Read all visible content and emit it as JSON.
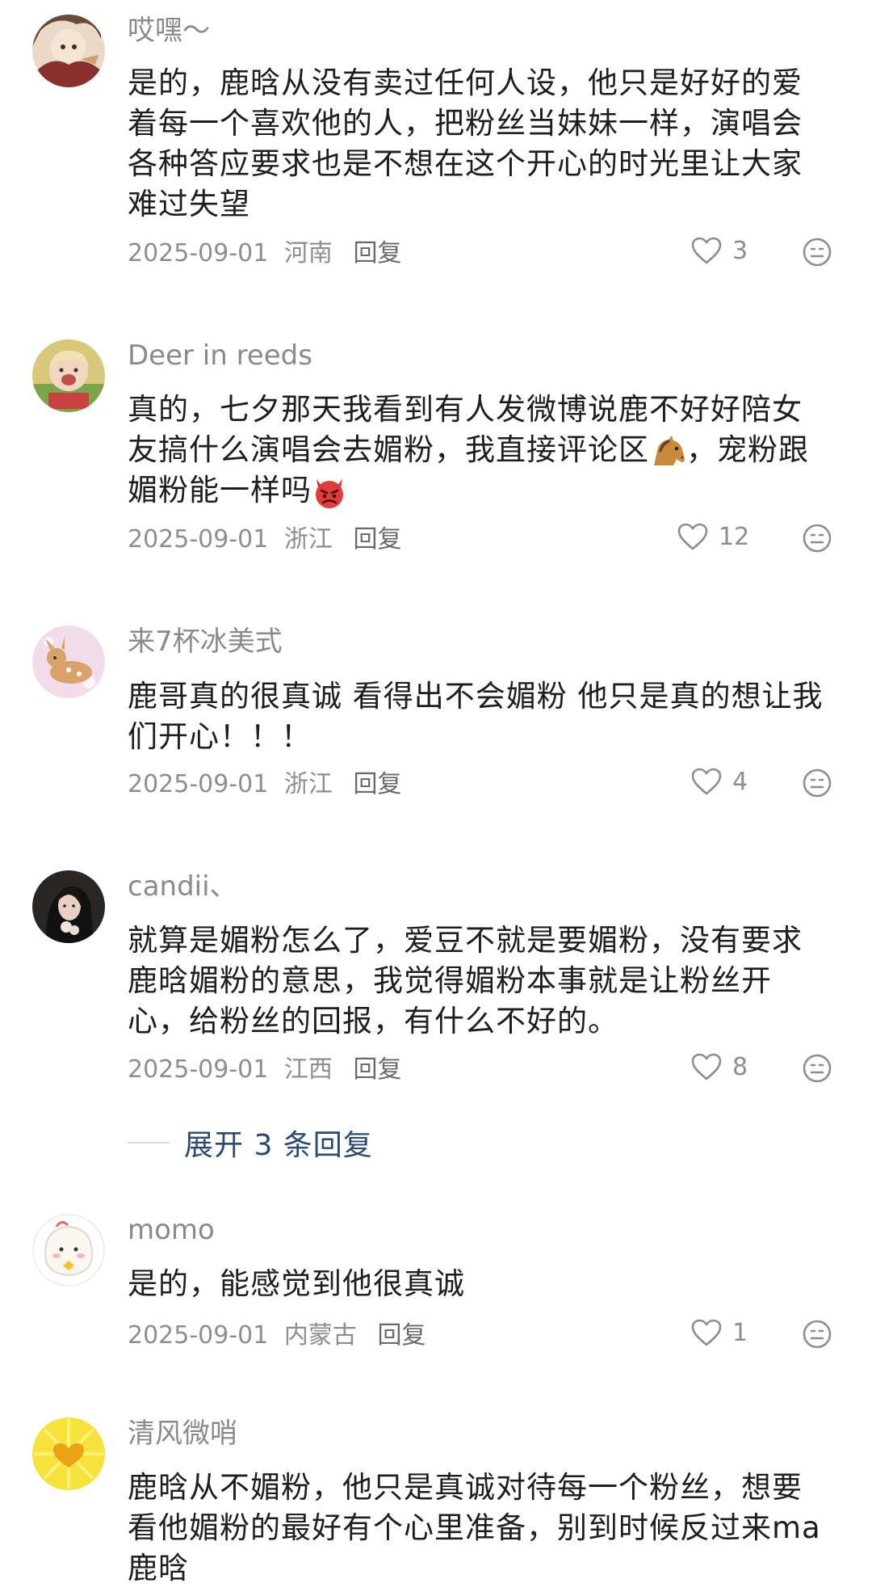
{
  "comments": [
    {
      "username": "哎嘿～",
      "lines": [
        "是的，鹿晗从没有卖过任何人设，他只是好好的爱",
        "着每一个喜欢他的人，把粉丝当妹妹一样，演唱会",
        "各种答应要求也是不想在这个开心的时光里让大家",
        "难过失望"
      ],
      "date": "2025-09-01",
      "location": "河南",
      "reply_label": "回复",
      "likes": "3",
      "avatar_icon": "anime-avatar"
    },
    {
      "username": "Deer in reeds",
      "lines": [
        "真的，七夕那天我看到有人发微博说鹿不好好陪女",
        "友搞什么演唱会去媚粉，我直接评论区",
        "，宠粉跟",
        "媚粉能一样吗"
      ],
      "date": "2025-09-01",
      "location": "浙江",
      "reply_label": "回复",
      "likes": "12",
      "avatar_icon": "photo-avatar"
    },
    {
      "username": "来7杯冰美式",
      "lines": [
        "鹿哥真的很真诚 看得出不会媚粉 他只是真的想让我",
        "们开心！！！"
      ],
      "date": "2025-09-01",
      "location": "浙江",
      "reply_label": "回复",
      "likes": "4",
      "avatar_icon": "deer-avatar"
    },
    {
      "username": "candii、",
      "lines": [
        "就算是媚粉怎么了，爱豆不就是要媚粉，没有要求",
        "鹿晗媚粉的意思，我觉得媚粉本事就是让粉丝开",
        "心，给粉丝的回报，有什么不好的。"
      ],
      "date": "2025-09-01",
      "location": "江西",
      "reply_label": "回复",
      "likes": "8",
      "avatar_icon": "portrait-avatar"
    },
    {
      "username": "momo",
      "lines": [
        "是的，能感觉到他很真诚"
      ],
      "date": "2025-09-01",
      "location": "内蒙古",
      "reply_label": "回复",
      "likes": "1",
      "avatar_icon": "cartoon-avatar"
    },
    {
      "username": "清风微哨",
      "lines": [
        "鹿晗从不媚粉，他只是真诚对待每一个粉丝，想要",
        "看他媚粉的最好有个心里准备，别到时候反过来ma",
        "鹿晗"
      ],
      "date": "",
      "location": "",
      "reply_label": "",
      "likes": "",
      "avatar_icon": "heart-avatar"
    }
  ],
  "expand_replies": "展开 3 条回复",
  "icons": {
    "like": "heart-outline-icon",
    "react": "emoji-react-icon",
    "horse": "horse-emoji",
    "angry": "angry-devil-emoji"
  },
  "colors": {
    "username": "#8a8a8a",
    "text": "#1e1e1e",
    "meta": "#8e8e8e",
    "expand": "#2a4a76"
  }
}
